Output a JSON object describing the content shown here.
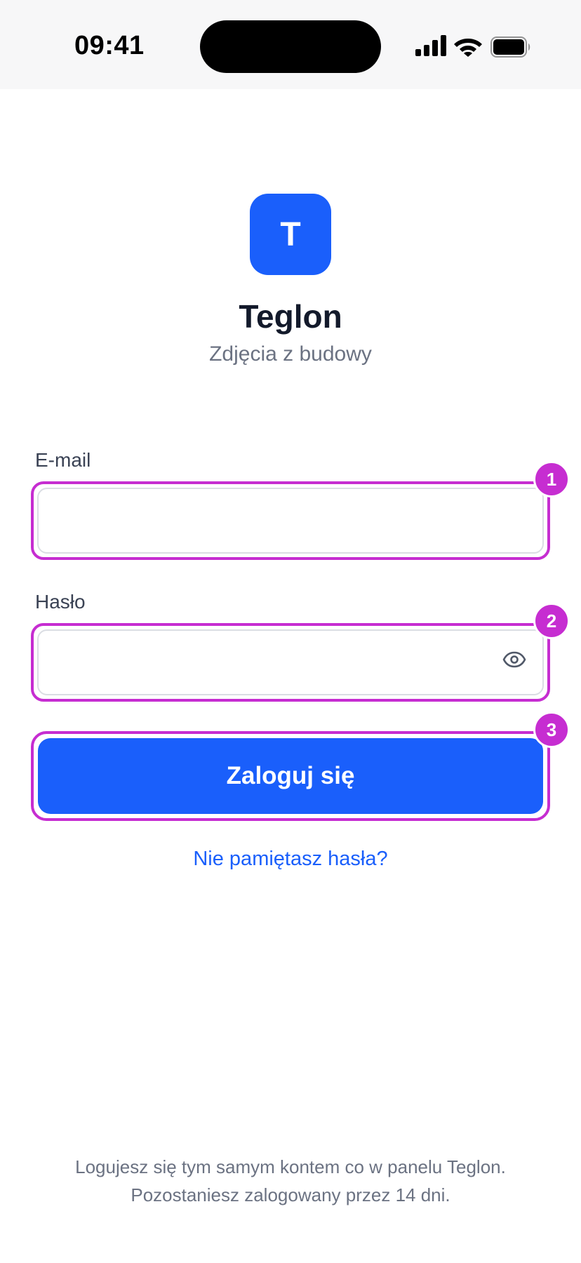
{
  "status_bar": {
    "time": "09:41",
    "icons": [
      "cellular-signal-icon",
      "wifi-icon",
      "battery-icon"
    ]
  },
  "brand": {
    "logo_letter": "T",
    "logo_color": "#1a5ffb",
    "title": "Teglon",
    "subtitle": "Zdjęcia z budowy"
  },
  "form": {
    "email": {
      "label": "E-mail",
      "value": "",
      "badge": "1"
    },
    "password": {
      "label": "Hasło",
      "value": "",
      "badge": "2",
      "toggle_icon": "eye-icon"
    },
    "submit": {
      "label": "Zaloguj się",
      "badge": "3"
    },
    "forgot_link": "Nie pamiętasz hasła?"
  },
  "footer": {
    "line1": "Logujesz się tym samym kontem co w panelu Teglon.",
    "line2": "Pozostaniesz zalogowany przez 14 dni."
  },
  "colors": {
    "accent": "#1a5ffb",
    "highlight": "#c62dd1",
    "muted_text": "#6b7282",
    "title_text": "#131a2b"
  }
}
